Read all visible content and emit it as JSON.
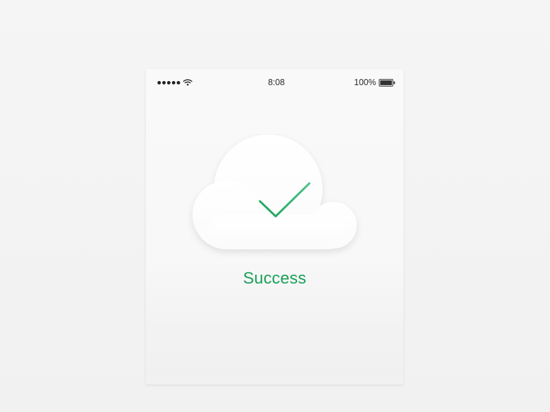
{
  "status_bar": {
    "signal_icon": "signal-dots-icon",
    "wifi_icon": "wifi-icon",
    "time": "8:08",
    "battery_percent": "100%",
    "battery_icon": "battery-full-icon"
  },
  "main": {
    "illustration_icon": "cloud-checkmark-icon",
    "status_text": "Success"
  },
  "colors": {
    "accent": "#1aa15a",
    "check_start": "#1ea35a",
    "check_end": "#4cc58a",
    "background": "#f4f4f4",
    "card": "#f9f9f9"
  }
}
